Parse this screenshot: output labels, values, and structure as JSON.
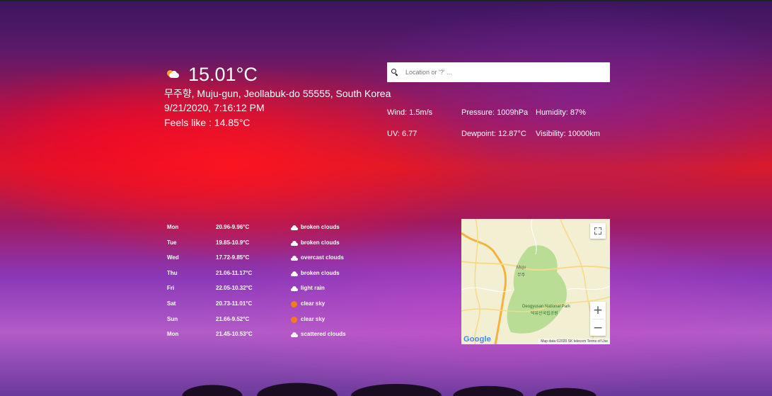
{
  "current": {
    "icon": "cloud-sun-icon",
    "temperature": "15.01°C",
    "location": "무주향, Muju-gun, Jeollabuk-do 55555, South Korea",
    "datetime": "9/21/2020, 7:16:12 PM",
    "feels_like": "Feels like : 14.85°C"
  },
  "search": {
    "placeholder": "Location or '?' ..."
  },
  "stats": {
    "wind": "Wind: 1.5m/s",
    "pressure": "Pressure: 1009hPa",
    "humidity": "Humidity: 87%",
    "uv": "UV: 6.77",
    "dewpoint": "Dewpoint: 12.87°C",
    "visibility": "Visibility: 10000km"
  },
  "forecast": [
    {
      "day": "Mon",
      "range": "20.96-9.96°C",
      "icon": "cloud-icon",
      "desc": "broken clouds"
    },
    {
      "day": "Tue",
      "range": "19.85-10.9°C",
      "icon": "cloud-icon",
      "desc": "broken clouds"
    },
    {
      "day": "Wed",
      "range": "17.72-9.85°C",
      "icon": "cloud-icon",
      "desc": "overcast clouds"
    },
    {
      "day": "Thu",
      "range": "21.06-11.17°C",
      "icon": "cloud-icon",
      "desc": "broken clouds"
    },
    {
      "day": "Fri",
      "range": "22.05-10.32°C",
      "icon": "rain-cloud-icon",
      "desc": "light rain"
    },
    {
      "day": "Sat",
      "range": "20.73-11.01°C",
      "icon": "sun-icon",
      "desc": "clear sky"
    },
    {
      "day": "Sun",
      "range": "21.66-9.52°C",
      "icon": "sun-icon",
      "desc": "clear sky"
    },
    {
      "day": "Mon",
      "range": "21.45-10.53°C",
      "icon": "cloud-icon",
      "desc": "scattered clouds"
    }
  ],
  "map": {
    "town_label": "Muju",
    "town_label_ko": "무주",
    "park_label": "Deogyusan National Park",
    "park_label_ko": "덕유산국립공원",
    "zoom_in": "+",
    "zoom_out": "−",
    "logo": "Google",
    "footer": "Map data ©2020 SK telecom   Terms of Use",
    "colors": {
      "land": "#f3efd3",
      "park": "#b9dd94",
      "highway": "#f6b23f",
      "road": "#f7d98a"
    }
  }
}
